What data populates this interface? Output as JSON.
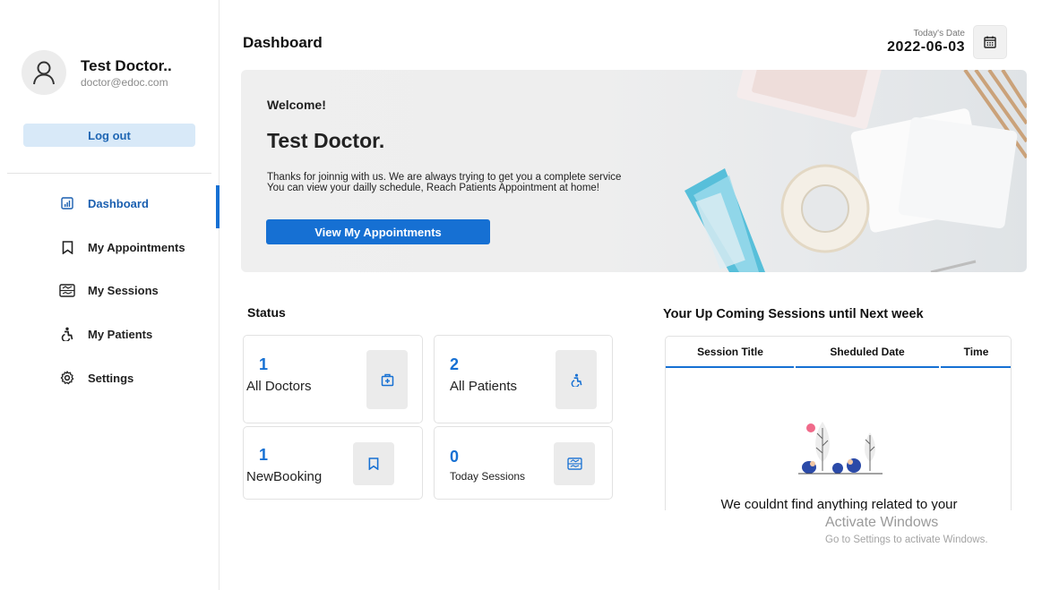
{
  "profile": {
    "name": "Test Doctor..",
    "email": "doctor@edoc.com"
  },
  "sidebar": {
    "logout_label": "Log out",
    "items": [
      {
        "label": "Dashboard",
        "icon": "dashboard-icon",
        "active": true
      },
      {
        "label": "My Appointments",
        "icon": "bookmark-icon"
      },
      {
        "label": "My Sessions",
        "icon": "schedule-icon"
      },
      {
        "label": "My Patients",
        "icon": "accessible-icon"
      },
      {
        "label": "Settings",
        "icon": "gear-icon"
      }
    ]
  },
  "header": {
    "title": "Dashboard",
    "date_label": "Today's Date",
    "date_value": "2022-06-03",
    "calendar_icon": "calendar-icon"
  },
  "banner": {
    "welcome": "Welcome!",
    "doctor_name": "Test Doctor.",
    "desc_line1": "Thanks for joinnig with us. We are always trying to get you a complete service",
    "desc_line2": "You can view your dailly schedule, Reach Patients Appointment at home!",
    "cta_label": "View My Appointments"
  },
  "status": {
    "title": "Status",
    "cards": [
      {
        "value": "1",
        "label": "All Doctors",
        "icon": "medical-kit-icon"
      },
      {
        "value": "2",
        "label": "All Patients",
        "icon": "accessible-icon"
      },
      {
        "value": "1",
        "label": "NewBooking",
        "icon": "bookmark-icon"
      },
      {
        "value": "0",
        "label": "Today Sessions",
        "icon": "schedule-icon"
      }
    ]
  },
  "sessions": {
    "title": "Your Up Coming Sessions until Next week",
    "columns": [
      "Session Title",
      "Sheduled Date",
      "Time"
    ],
    "empty_message": "We couldnt find anything related to your"
  },
  "watermark": {
    "line1": "Activate Windows",
    "line2": "Go to Settings to activate Windows."
  },
  "colors": {
    "accent": "#1670d3",
    "logout_bg": "#d8e9f8"
  }
}
